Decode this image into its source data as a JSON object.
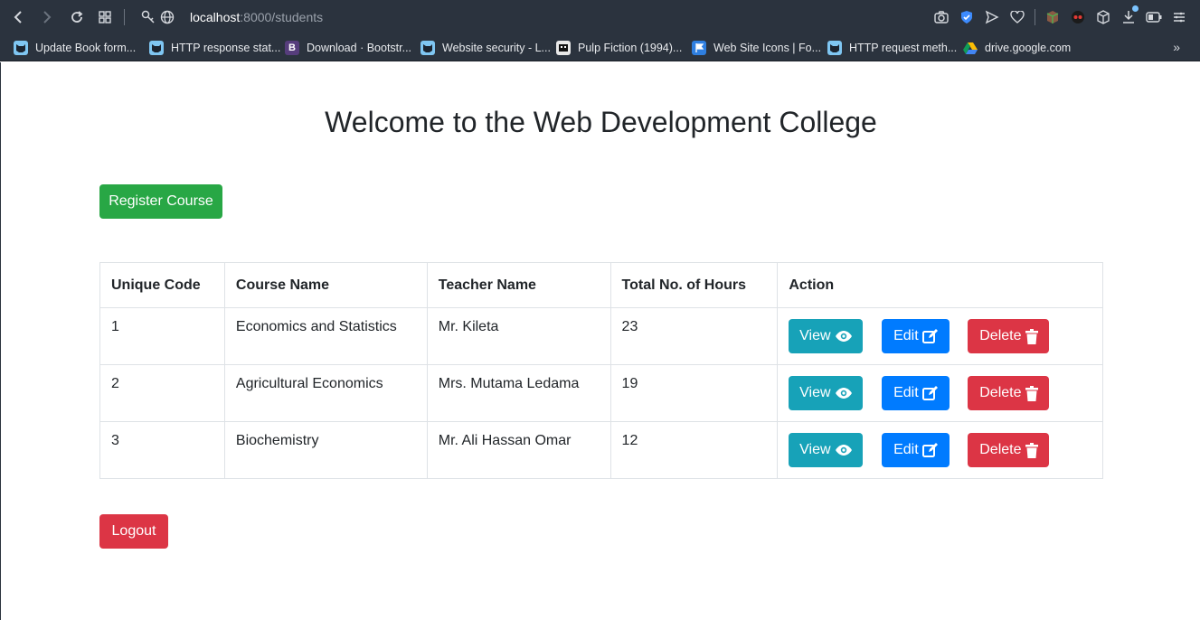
{
  "browser": {
    "url_host": "localhost",
    "url_path": ":8000/students",
    "bookmarks": [
      {
        "label": "Update Book form...",
        "icon": "cat-icon"
      },
      {
        "label": "HTTP response stat...",
        "icon": "cat-icon"
      },
      {
        "label": "Download · Bootstr...",
        "icon": "bootstrap-icon",
        "glyph": "B"
      },
      {
        "label": "Website security - L...",
        "icon": "cat-icon"
      },
      {
        "label": "Pulp Fiction (1994)...",
        "icon": "imdb-icon"
      },
      {
        "label": "Web Site Icons | Fo...",
        "icon": "flag-icon"
      },
      {
        "label": "HTTP request meth...",
        "icon": "cat-icon"
      },
      {
        "label": "drive.google.com",
        "icon": "drive-icon"
      }
    ],
    "more": "»"
  },
  "page": {
    "title": "Welcome to the Web Development College",
    "register_label": "Register Course",
    "logout_label": "Logout"
  },
  "table": {
    "headers": [
      "Unique Code",
      "Course Name",
      "Teacher Name",
      "Total No. of Hours",
      "Action"
    ],
    "rows": [
      {
        "code": "1",
        "course": "Economics and Statistics",
        "teacher": "Mr. Kileta",
        "hours": "23"
      },
      {
        "code": "2",
        "course": "Agricultural Economics",
        "teacher": "Mrs. Mutama Ledama",
        "hours": "19"
      },
      {
        "code": "3",
        "course": "Biochemistry",
        "teacher": "Mr. Ali Hassan Omar",
        "hours": "12"
      }
    ],
    "actions": {
      "view": "View",
      "edit": "Edit",
      "delete": "Delete"
    }
  },
  "colors": {
    "success": "#28a745",
    "danger": "#dc3545",
    "info": "#17a2b8",
    "primary": "#007bff"
  }
}
